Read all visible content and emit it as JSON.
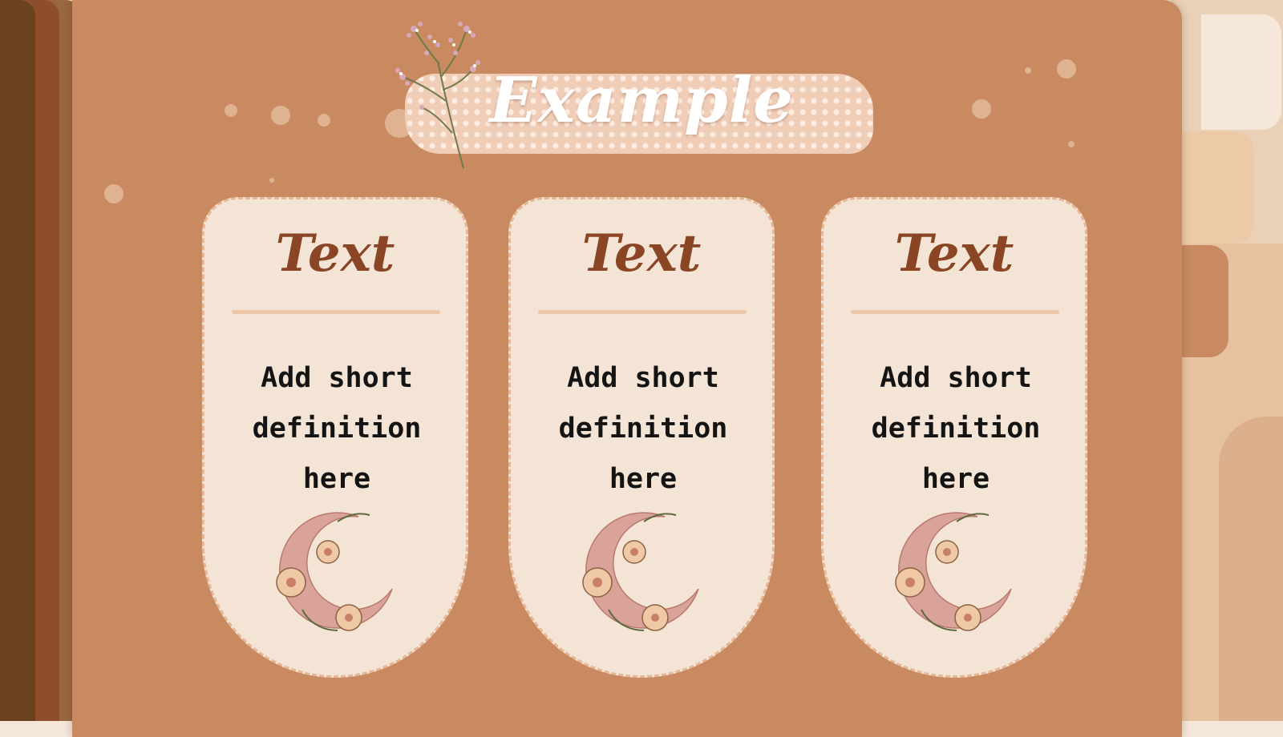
{
  "title": "Example",
  "cards": [
    {
      "title": "Text",
      "text": "Add short definition here"
    },
    {
      "title": "Text",
      "text": "Add short definition here"
    },
    {
      "title": "Text",
      "text": "Add short definition here"
    }
  ],
  "colors": {
    "main_folder": "#c98a62",
    "card_bg": "#f3e4d5",
    "card_border": "#e6b898",
    "card_title": "#8a4525",
    "body_text": "#141414",
    "title_text": "#ffffff",
    "title_band": "#f0cdb7"
  },
  "decorations": {
    "top_flower": "babys-breath-sprig-icon",
    "card_emblem": "floral-crescent-moon-icon"
  }
}
